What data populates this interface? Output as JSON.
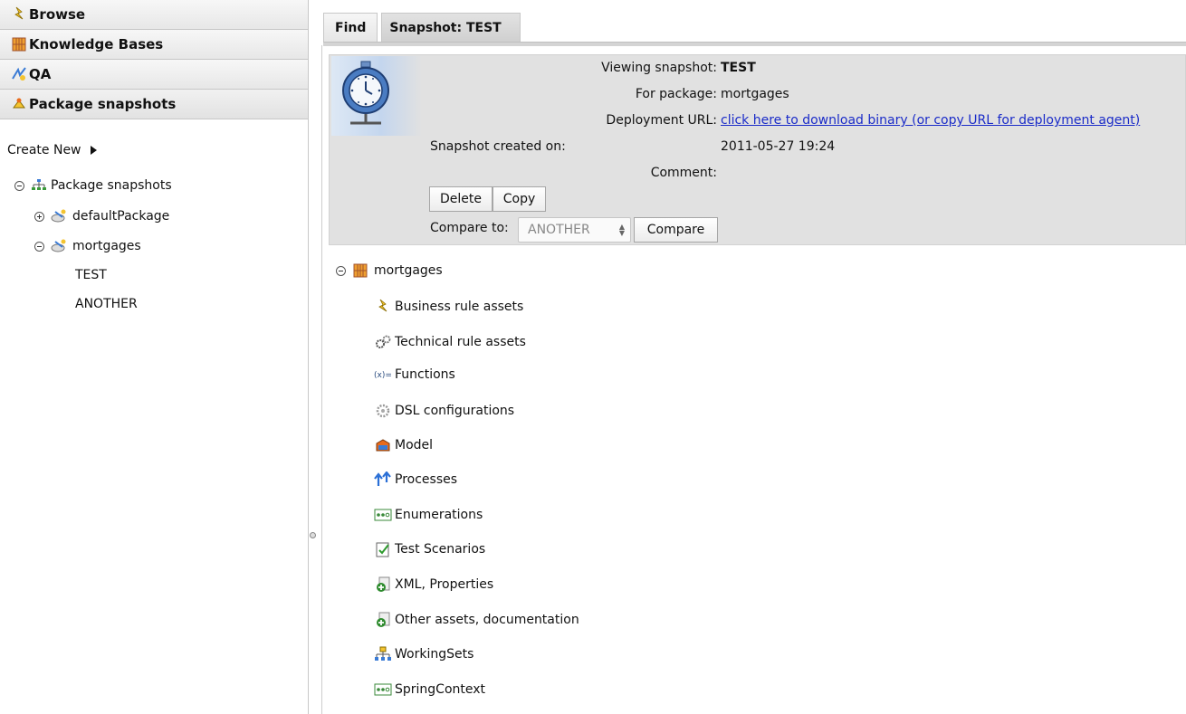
{
  "sidebar": {
    "headers": [
      {
        "label": "Browse",
        "icon": "rule-icon"
      },
      {
        "label": "Knowledge Bases",
        "icon": "package-icon"
      },
      {
        "label": "QA",
        "icon": "qa-icon"
      },
      {
        "label": "Package snapshots",
        "icon": "snapshot-icon"
      }
    ],
    "create_new": "Create New",
    "tree": {
      "root": "Package snapshots",
      "packages": [
        {
          "label": "defaultPackage",
          "expanded": false
        },
        {
          "label": "mortgages",
          "expanded": true,
          "children": [
            "TEST",
            "ANOTHER"
          ]
        }
      ]
    }
  },
  "tabs": [
    {
      "label": "Find",
      "active": false
    },
    {
      "label": "Snapshot: TEST",
      "active": true
    }
  ],
  "snapshot": {
    "viewing_label": "Viewing snapshot:",
    "viewing_value": "TEST",
    "package_label": "For package:",
    "package_value": "mortgages",
    "url_label": "Deployment URL:",
    "url_link": "click here to download binary (or copy URL for deployment agent)",
    "created_label": "Snapshot created on:",
    "created_value": "2011-05-27 19:24",
    "comment_label": "Comment:",
    "delete_label": "Delete",
    "copy_label": "Copy",
    "compare_to_label": "Compare to:",
    "compare_select_value": "ANOTHER",
    "compare_button": "Compare"
  },
  "explorer": {
    "package": "mortgages",
    "items": [
      {
        "label": "Business rule assets",
        "icon": "business-rule-icon"
      },
      {
        "label": "Technical rule assets",
        "icon": "gears-icon"
      },
      {
        "label": "Functions",
        "icon": "function-icon"
      },
      {
        "label": "DSL configurations",
        "icon": "dsl-icon"
      },
      {
        "label": "Model",
        "icon": "model-icon"
      },
      {
        "label": "Processes",
        "icon": "process-icon"
      },
      {
        "label": "Enumerations",
        "icon": "enumeration-icon"
      },
      {
        "label": "Test Scenarios",
        "icon": "test-scenario-icon"
      },
      {
        "label": "XML, Properties",
        "icon": "add-document-icon"
      },
      {
        "label": "Other assets, documentation",
        "icon": "add-document-icon"
      },
      {
        "label": "WorkingSets",
        "icon": "working-sets-icon"
      },
      {
        "label": "SpringContext",
        "icon": "enumeration-icon"
      }
    ]
  }
}
